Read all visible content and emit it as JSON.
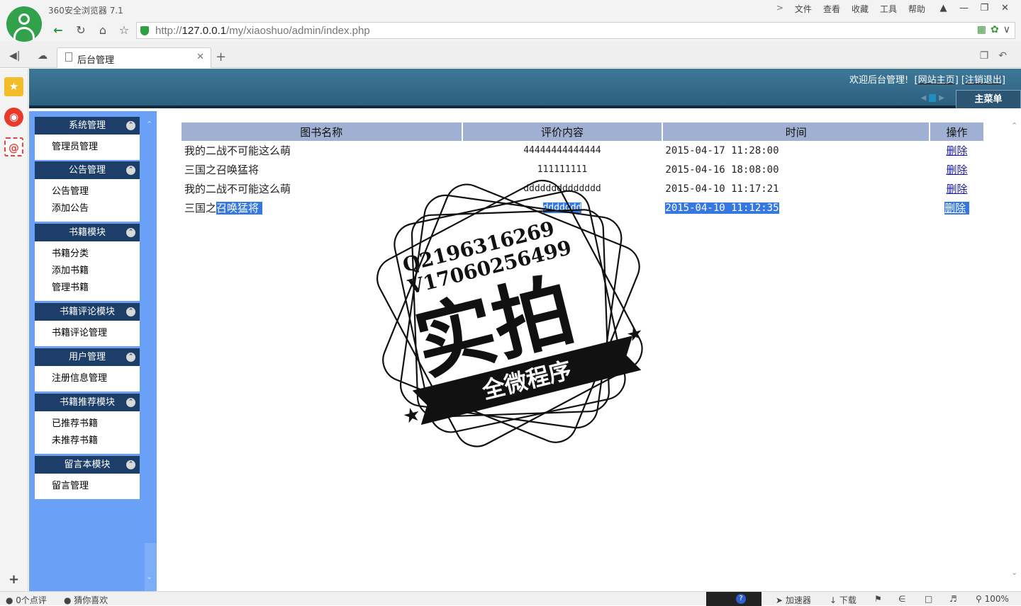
{
  "browser": {
    "app_title": "360安全浏览器 7.1",
    "menus": [
      "文件",
      "查看",
      "收藏",
      "工具",
      "帮助"
    ],
    "url_prefix": "http://",
    "url_host": "127.0.0.1",
    "url_path": "/my/xiaoshuo/admin/index.php",
    "tab_title": "后台管理",
    "status_comments": "0个点评",
    "status_guess": "猜你喜欢",
    "status_accelerator": "加速器",
    "status_download": "下载",
    "status_zoom": "100%"
  },
  "header": {
    "welcome": "欢迎后台管理!",
    "site_home": "网站主页",
    "logout": "注销退出",
    "main_menu": "主菜单"
  },
  "sidebar": {
    "groups": [
      {
        "title": "系统管理",
        "items": [
          "管理员管理"
        ]
      },
      {
        "title": "公告管理",
        "items": [
          "公告管理",
          "添加公告"
        ]
      },
      {
        "title": "书籍模块",
        "items": [
          "书籍分类",
          "添加书籍",
          "管理书籍"
        ]
      },
      {
        "title": "书籍评论模块",
        "items": [
          "书籍评论管理"
        ]
      },
      {
        "title": "用户管理",
        "items": [
          "注册信息管理"
        ]
      },
      {
        "title": "书籍推荐模块",
        "items": [
          "已推荐书籍",
          "未推荐书籍"
        ]
      },
      {
        "title": "留言本模块",
        "items": [
          "留言管理"
        ]
      }
    ]
  },
  "table": {
    "headers": [
      "图书名称",
      "评价内容",
      "时间",
      "操作"
    ],
    "rows": [
      {
        "name": "我的二战不可能这么萌",
        "content": "44444444444444",
        "time": "2015-04-17 11:28:00",
        "action": "删除"
      },
      {
        "name": "三国之召唤猛将",
        "content": "111111111",
        "time": "2015-04-16 18:08:00",
        "action": "删除"
      },
      {
        "name": "我的二战不可能这么萌",
        "content": "dddddddddddddd",
        "time": "2015-04-10 11:17:21",
        "action": "删除"
      },
      {
        "name_plain": "三国之",
        "name_selected": "召唤猛将",
        "content": "ddddddd",
        "time": "2015-04-10 11:12:35",
        "action": "删除"
      }
    ]
  },
  "watermark": {
    "line1": "Q2196316269",
    "line2": "V17060256499",
    "big": "实拍",
    "ribbon": "全微程序"
  },
  "colors": {
    "header_bg": "#3d7898",
    "sidebar_bg": "#6aa0f5",
    "group_head": "#1c3e68",
    "table_head": "#a0b0d2",
    "selection": "#3478e0"
  }
}
